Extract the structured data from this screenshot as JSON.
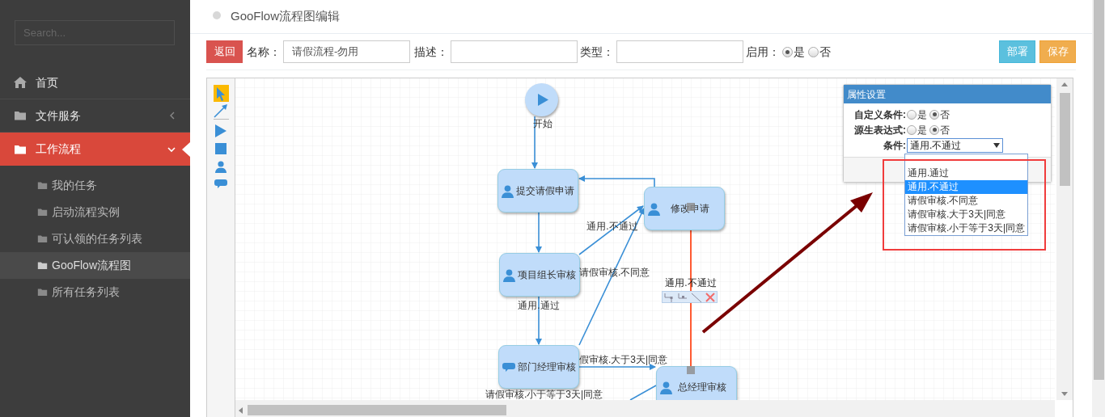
{
  "sidebar": {
    "search": {
      "placeholder": "Search..."
    },
    "items": [
      {
        "label": "首页",
        "kind": "link",
        "selected": false
      },
      {
        "label": "文件服务",
        "kind": "group",
        "expanded": false,
        "selected": false
      },
      {
        "label": "工作流程",
        "kind": "group",
        "expanded": true,
        "selected": true,
        "children": [
          {
            "label": "我的任务",
            "selected": false
          },
          {
            "label": "启动流程实例",
            "selected": false
          },
          {
            "label": "可认领的任务列表",
            "selected": false
          },
          {
            "label": "GooFlow流程图",
            "selected": true
          },
          {
            "label": "所有任务列表",
            "selected": false
          }
        ]
      }
    ]
  },
  "page": {
    "title": "GooFlow流程图编辑"
  },
  "form": {
    "back_button": "返回",
    "fields": [
      {
        "label": "名称：",
        "value": "请假流程-勿用"
      },
      {
        "label": "描述："
      },
      {
        "label": "类型："
      }
    ],
    "enabled": {
      "label": "启用：",
      "options": [
        {
          "label": "是",
          "selected": true
        },
        {
          "label": "否",
          "selected": false
        }
      ]
    },
    "buttons": [
      {
        "label": "部署",
        "kind": "info"
      },
      {
        "label": "保存",
        "kind": "warning"
      }
    ]
  },
  "toolbox": [
    {
      "kind": "pointer",
      "selected": true
    },
    {
      "kind": "line",
      "selected": false
    },
    {
      "kind": "start",
      "selected": false
    },
    {
      "kind": "end",
      "selected": false
    },
    {
      "kind": "task",
      "selected": false
    },
    {
      "kind": "chat",
      "selected": false
    }
  ],
  "diagram": {
    "nodes": [
      {
        "kind": "start",
        "label": "开始"
      },
      {
        "kind": "task",
        "label": "提交请假申请"
      },
      {
        "kind": "task",
        "label": "修改申请"
      },
      {
        "kind": "task",
        "label": "项目组长审核"
      },
      {
        "kind": "chat",
        "label": "部门经理审核"
      },
      {
        "kind": "task",
        "label": "总经理审核"
      }
    ],
    "edges": [
      {
        "label": "通用.不通过",
        "selected": false
      },
      {
        "label": "请假审核.不同意",
        "selected": false
      },
      {
        "label": "通用.通过",
        "selected": false
      },
      {
        "label": "通用.不通过",
        "selected": true
      },
      {
        "label": "假审核.大于3天|同意",
        "selected": false
      },
      {
        "label": "请假审核.小于等于3天|同意",
        "selected": false
      }
    ]
  },
  "properties": {
    "title": "属性设置",
    "rows": [
      {
        "kind": "radio",
        "label": "自定义条件:",
        "options": [
          {
            "label": "是",
            "selected": false
          },
          {
            "label": "否",
            "selected": true
          }
        ]
      },
      {
        "kind": "radio",
        "label": "源生表达式:",
        "options": [
          {
            "label": "是",
            "selected": false
          },
          {
            "label": "否",
            "selected": true
          }
        ]
      },
      {
        "kind": "select",
        "label": "条件:",
        "value": "通用.不通过",
        "expanded": true,
        "options": [
          {
            "label": "通用.通过",
            "selected": false
          },
          {
            "label": "通用.不通过",
            "selected": true
          },
          {
            "label": "请假审核.不同意",
            "selected": false
          },
          {
            "label": "请假审核.大于3天|同意",
            "selected": false
          },
          {
            "label": "请假审核.小于等于3天|同意",
            "selected": false
          }
        ]
      }
    ]
  }
}
